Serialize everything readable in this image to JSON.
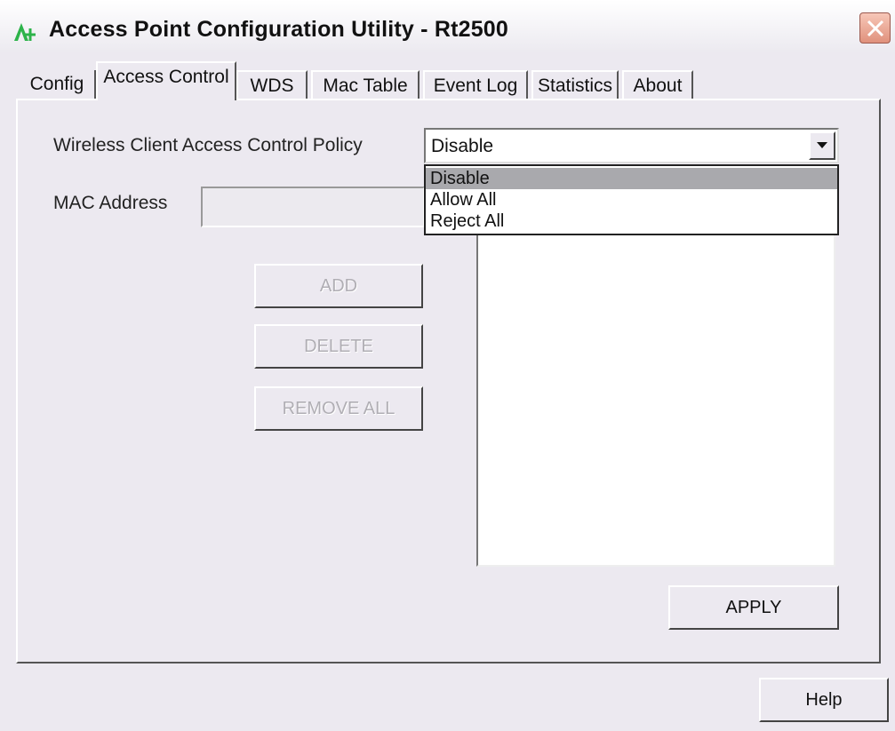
{
  "window": {
    "title": "Access Point Configuration Utility - Rt2500",
    "app_icon": "green-antenna-icon",
    "close_icon": "close-icon"
  },
  "tabs": [
    {
      "label": "Config"
    },
    {
      "label": "Access Control",
      "active": true
    },
    {
      "label": "WDS"
    },
    {
      "label": "Mac Table"
    },
    {
      "label": "Event Log"
    },
    {
      "label": "Statistics"
    },
    {
      "label": "About"
    }
  ],
  "access_control": {
    "policy_label": "Wireless Client Access Control Policy",
    "policy_value": "Disable",
    "policy_options": [
      "Disable",
      "Allow All",
      "Reject All"
    ],
    "mac_label": "MAC Address",
    "mac_value": "",
    "add_label": "ADD",
    "delete_label": "DELETE",
    "remove_all_label": "REMOVE ALL",
    "apply_label": "APPLY"
  },
  "footer": {
    "help_label": "Help"
  },
  "colors": {
    "window_bg": "#ece9f0",
    "selected_option": "#a9a9ad",
    "disabled_text": "#b0aeb4"
  }
}
